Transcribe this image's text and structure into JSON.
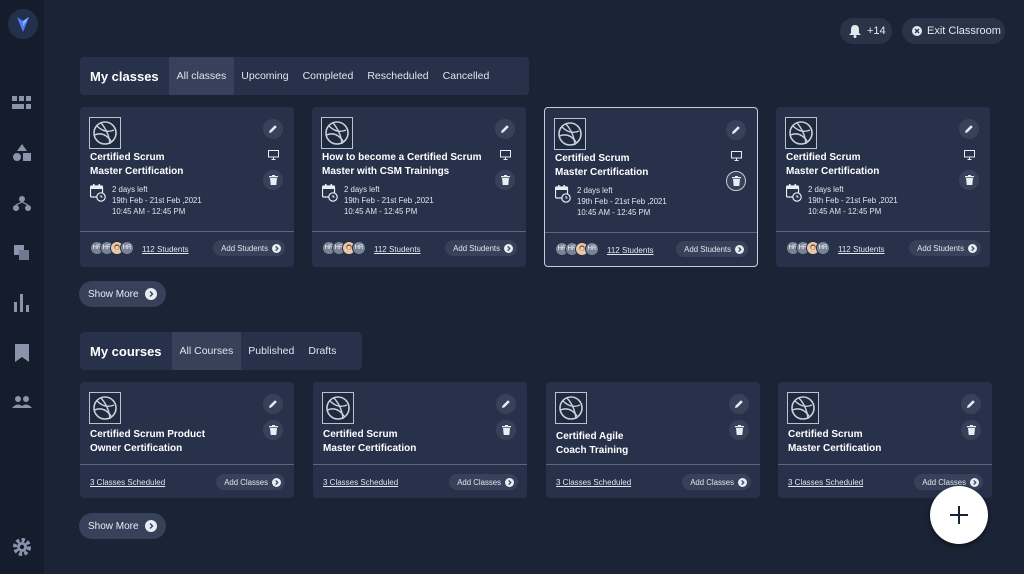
{
  "topbar": {
    "notif_count": "+14",
    "exit_label": "Exit Classroom"
  },
  "classes": {
    "title": "My classes",
    "tabs": [
      "All classes",
      "Upcoming",
      "Completed",
      "Rescheduled",
      "Cancelled"
    ],
    "cards": [
      {
        "title_line1": "Certified Scrum",
        "title_line2": "Master Certification",
        "days_left": "2 days left",
        "dates": "19th Feb - 21st Feb ,2021",
        "time": "10:45 AM - 12:45 PM",
        "students": "112 Students",
        "add_label": "Add Students",
        "av1": "HR",
        "av2": "HR",
        "av4": "HR"
      },
      {
        "title_line1": "How to become a Certified Scrum",
        "title_line2": "Master with CSM Trainings",
        "days_left": "2 days left",
        "dates": "19th Feb - 21st Feb ,2021",
        "time": "10:45 AM - 12:45 PM",
        "students": "112 Students",
        "add_label": "Add Students",
        "av1": "HR",
        "av2": "HR",
        "av4": "HR"
      },
      {
        "title_line1": "Certified Scrum",
        "title_line2": "Master Certification",
        "days_left": "2 days left",
        "dates": "19th Feb - 21st Feb ,2021",
        "time": "10:45 AM - 12:45 PM",
        "students": "112 Students",
        "add_label": "Add Students",
        "av1": "HR",
        "av2": "HR",
        "av4": "HR"
      },
      {
        "title_line1": "Certified Scrum",
        "title_line2": "Master Certification",
        "days_left": "2 days left",
        "dates": "19th Feb - 21st Feb ,2021",
        "time": "10:45 AM - 12:45 PM",
        "students": "112 Students",
        "add_label": "Add Students",
        "av1": "HR",
        "av2": "HR",
        "av4": "HR"
      }
    ],
    "show_more": "Show More"
  },
  "courses": {
    "title": "My courses",
    "tabs": [
      "All Courses",
      "Published",
      "Drafts"
    ],
    "cards": [
      {
        "title_line1": "Certified Scrum Product",
        "title_line2": "Owner Certification",
        "scheduled": "3 Classes Scheduled",
        "add_label": "Add Classes"
      },
      {
        "title_line1": "Certified Scrum",
        "title_line2": "Master Certification",
        "scheduled": "3 Classes Scheduled",
        "add_label": "Add Classes"
      },
      {
        "title_line1": "Certified Agile",
        "title_line2": "Coach Training",
        "scheduled": "3 Classes Scheduled",
        "add_label": "Add Classes"
      },
      {
        "title_line1": "Certified Scrum",
        "title_line2": "Master Certification",
        "scheduled": "3 Classes Scheduled",
        "add_label": "Add Classes"
      }
    ],
    "show_more": "Show More"
  },
  "colors": {
    "background": "#1b2436",
    "sidebar": "#151d2d",
    "card": "#27324a",
    "accent": "#4f7cff"
  }
}
